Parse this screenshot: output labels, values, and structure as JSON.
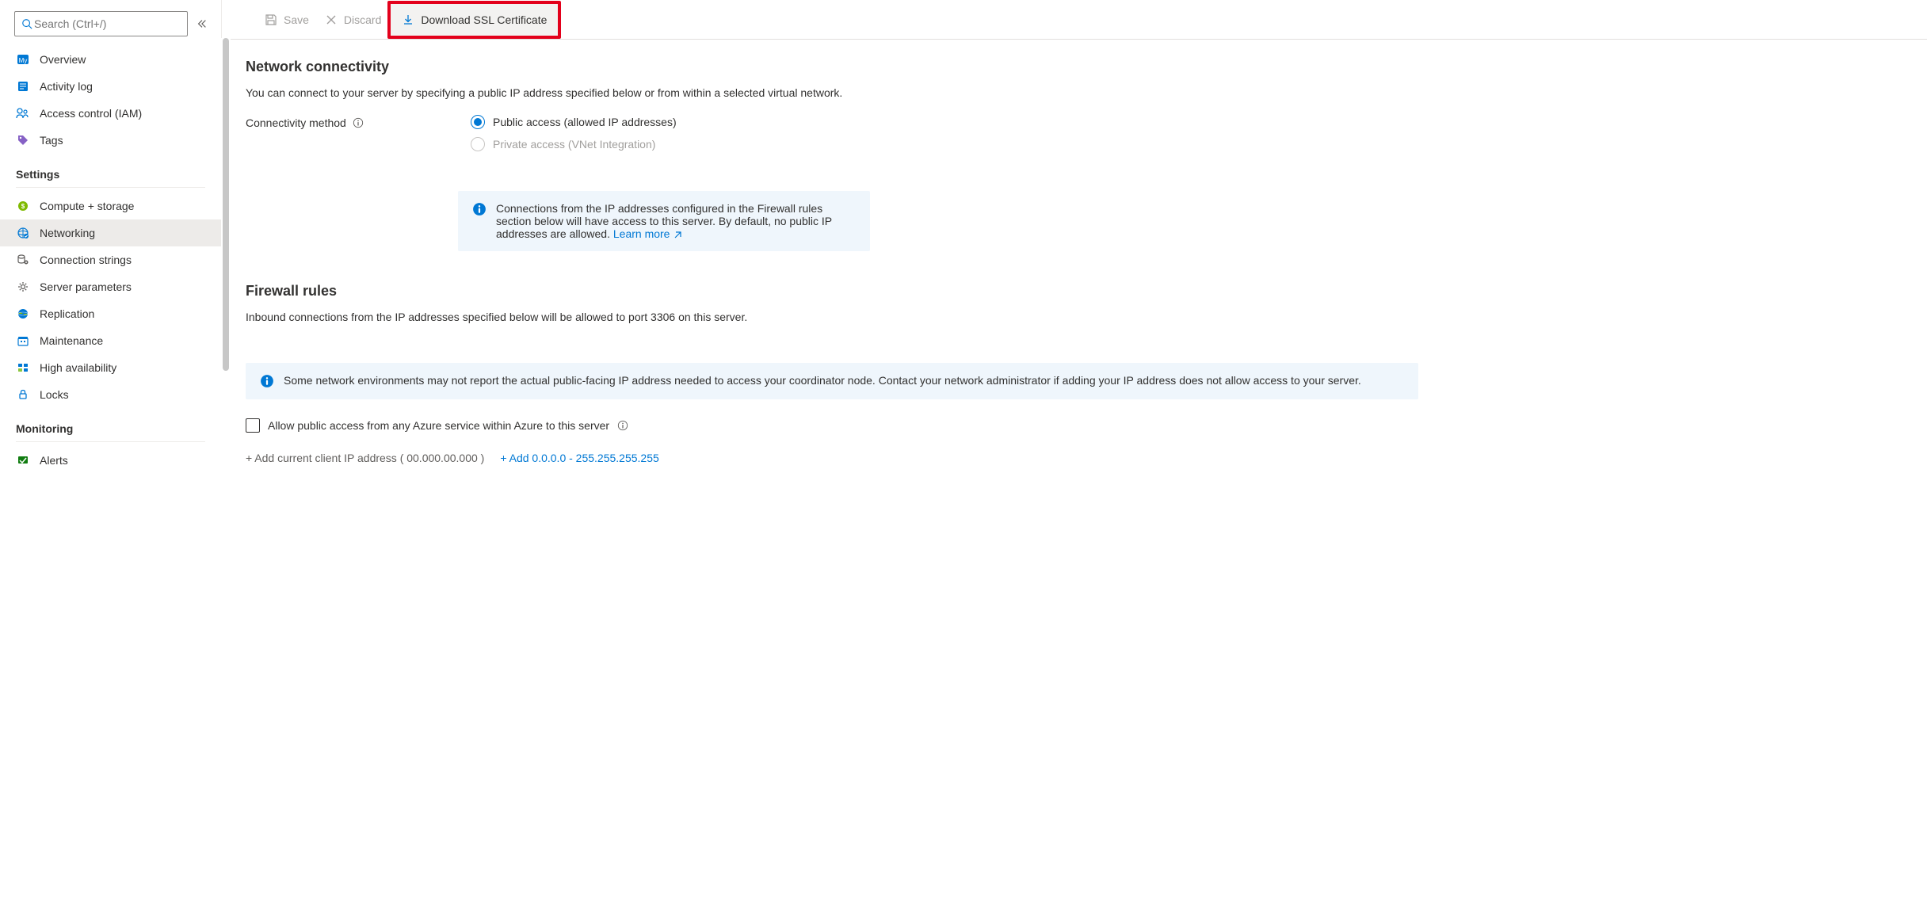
{
  "sidebar": {
    "search_placeholder": "Search (Ctrl+/)",
    "nav1": [
      {
        "label": "Overview"
      },
      {
        "label": "Activity log"
      },
      {
        "label": "Access control (IAM)"
      },
      {
        "label": "Tags"
      }
    ],
    "settings_title": "Settings",
    "settings_items": [
      {
        "label": "Compute + storage"
      },
      {
        "label": "Networking"
      },
      {
        "label": "Connection strings"
      },
      {
        "label": "Server parameters"
      },
      {
        "label": "Replication"
      },
      {
        "label": "Maintenance"
      },
      {
        "label": "High availability"
      },
      {
        "label": "Locks"
      }
    ],
    "monitoring_title": "Monitoring",
    "monitoring_items": [
      {
        "label": "Alerts"
      }
    ]
  },
  "toolbar": {
    "save": "Save",
    "discard": "Discard",
    "download_ssl": "Download SSL Certificate"
  },
  "content": {
    "network_connectivity_title": "Network connectivity",
    "network_desc": "You can connect to your server by specifying a public IP address specified below or from within a selected virtual network.",
    "connectivity_method_label": "Connectivity method",
    "radio_public": "Public access (allowed IP addresses)",
    "radio_private": "Private access (VNet Integration)",
    "info1_text": "Connections from the IP addresses configured in the Firewall rules section below will have access to this server. By default, no public IP addresses are allowed. ",
    "info1_link": "Learn more",
    "firewall_title": "Firewall rules",
    "firewall_desc": "Inbound connections from the IP addresses specified below will be allowed to port 3306 on this server.",
    "info2_text": "Some network environments may not report the actual public-facing IP address needed to access your coordinator node. Contact your network administrator if adding your IP address does not allow access to your server.",
    "allow_public_label": "Allow public access from any Azure service within Azure to this server",
    "add_current_prefix": "+ Add current client IP address ",
    "add_current_ip": "( 00.000.00.000 )",
    "add_range": "+ Add 0.0.0.0 - 255.255.255.255"
  }
}
